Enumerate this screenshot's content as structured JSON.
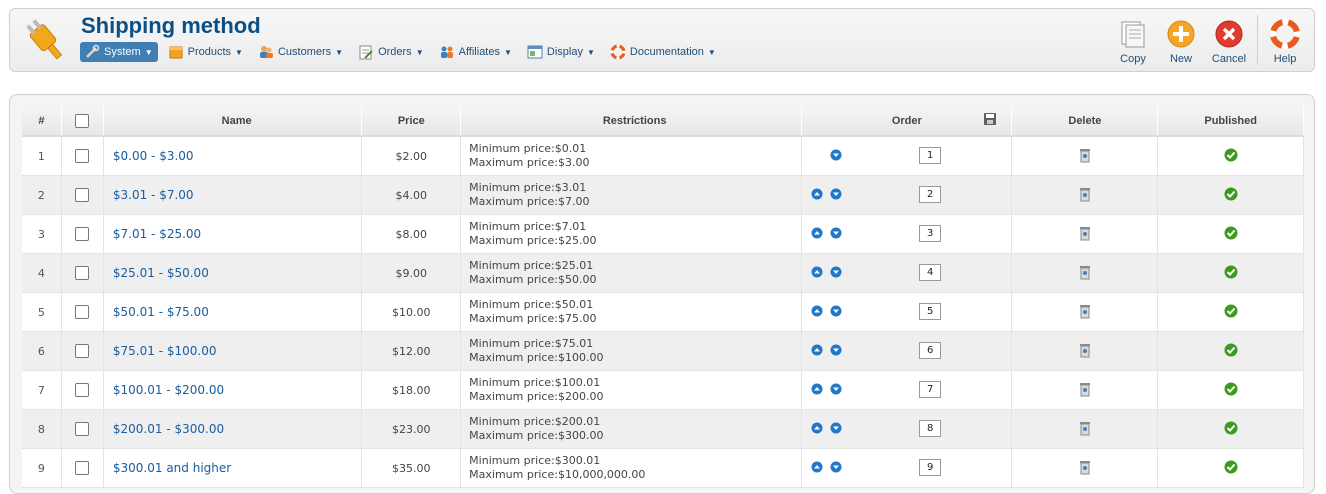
{
  "header": {
    "title": "Shipping method",
    "menu": [
      {
        "label": "System",
        "icon": "tools-icon",
        "active": true
      },
      {
        "label": "Products",
        "icon": "box-icon"
      },
      {
        "label": "Customers",
        "icon": "users-icon"
      },
      {
        "label": "Orders",
        "icon": "orders-icon"
      },
      {
        "label": "Affiliates",
        "icon": "affiliates-icon"
      },
      {
        "label": "Display",
        "icon": "display-icon"
      },
      {
        "label": "Documentation",
        "icon": "lifebuoy-icon"
      }
    ],
    "toolbar": {
      "copy_label": "Copy",
      "new_label": "New",
      "cancel_label": "Cancel",
      "help_label": "Help"
    }
  },
  "table": {
    "columns": {
      "num": "#",
      "name": "Name",
      "price": "Price",
      "restrictions": "Restrictions",
      "order": "Order",
      "delete": "Delete",
      "published": "Published"
    },
    "rows": [
      {
        "num": "1",
        "name": "$0.00 - $3.00",
        "price": "$2.00",
        "min": "Minimum price:$0.01",
        "max": "Maximum price:$3.00",
        "order": "1",
        "up": false,
        "down": true,
        "published": true
      },
      {
        "num": "2",
        "name": "$3.01 - $7.00",
        "price": "$4.00",
        "min": "Minimum price:$3.01",
        "max": "Maximum price:$7.00",
        "order": "2",
        "up": true,
        "down": true,
        "published": true
      },
      {
        "num": "3",
        "name": "$7.01 - $25.00",
        "price": "$8.00",
        "min": "Minimum price:$7.01",
        "max": "Maximum price:$25.00",
        "order": "3",
        "up": true,
        "down": true,
        "published": true
      },
      {
        "num": "4",
        "name": "$25.01 - $50.00",
        "price": "$9.00",
        "min": "Minimum price:$25.01",
        "max": "Maximum price:$50.00",
        "order": "4",
        "up": true,
        "down": true,
        "published": true
      },
      {
        "num": "5",
        "name": "$50.01 - $75.00",
        "price": "$10.00",
        "min": "Minimum price:$50.01",
        "max": "Maximum price:$75.00",
        "order": "5",
        "up": true,
        "down": true,
        "published": true
      },
      {
        "num": "6",
        "name": "$75.01 - $100.00",
        "price": "$12.00",
        "min": "Minimum price:$75.01",
        "max": "Maximum price:$100.00",
        "order": "6",
        "up": true,
        "down": true,
        "published": true
      },
      {
        "num": "7",
        "name": "$100.01 - $200.00",
        "price": "$18.00",
        "min": "Minimum price:$100.01",
        "max": "Maximum price:$200.00",
        "order": "7",
        "up": true,
        "down": true,
        "published": true
      },
      {
        "num": "8",
        "name": "$200.01 - $300.00",
        "price": "$23.00",
        "min": "Minimum price:$200.01",
        "max": "Maximum price:$300.00",
        "order": "8",
        "up": true,
        "down": true,
        "published": true
      },
      {
        "num": "9",
        "name": "$300.01 and higher",
        "price": "$35.00",
        "min": "Minimum price:$300.01",
        "max": "Maximum price:$10,000,000.00",
        "order": "9",
        "up": true,
        "down": true,
        "published": true
      }
    ]
  },
  "colors": {
    "title": "#0b4f87",
    "link": "#1a5da0",
    "active_menu": "#3f7fb3",
    "published_green": "#3c9a1f",
    "arrow_blue": "#1f78c8"
  }
}
